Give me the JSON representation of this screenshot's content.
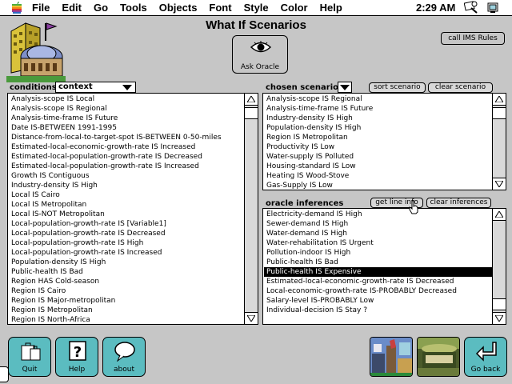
{
  "menubar": {
    "menus": [
      "File",
      "Edit",
      "Go",
      "Tools",
      "Objects",
      "Font",
      "Style",
      "Color",
      "Help"
    ],
    "clock": "2:29 AM"
  },
  "title": "What If Scenarios",
  "buttons": {
    "ask_oracle": "Ask Oracle",
    "call_ims_rules": "call IMS Rules",
    "sort_scenario": "sort scenario",
    "clear_scenario": "clear scenario",
    "get_line_info": "get line info",
    "clear_inferences": "clear inferences",
    "quit": "Quit",
    "help": "Help",
    "about": "about",
    "go_back": "Go back"
  },
  "conditions": {
    "label": "conditions",
    "context_value": "context",
    "items": [
      "Analysis-scope IS Local",
      "Analysis-scope IS Regional",
      "Analysis-time-frame IS Future",
      "Date IS-BETWEEN 1991-1995",
      "Distance-from-local-to-target-spot IS-BETWEEN 0-50-miles",
      "Estimated-local-economic-growth-rate IS Increased",
      "Estimated-local-population-growth-rate IS Decreased",
      "Estimated-local-population-growth-rate IS Increased",
      "Growth IS Contiguous",
      "Industry-density  IS High",
      "Local IS Cairo",
      "Local IS Metropolitan",
      "Local IS-NOT Metropolitan",
      "Local-population-growth-rate IS [Variable1]",
      "Local-population-growth-rate IS Decreased",
      "Local-population-growth-rate IS High",
      "Local-population-growth-rate IS Increased",
      "Population-density IS High",
      "Public-health IS Bad",
      "Region HAS Cold-season",
      "Region IS Cairo",
      "Region IS Major-metropolitan",
      "Region IS Metropolitan",
      "Region IS North-Africa"
    ]
  },
  "scenario": {
    "label": "chosen scenario",
    "items": [
      "Analysis-scope IS Regional",
      "Analysis-time-frame IS Future",
      "Industry-density  IS High",
      "Population-density IS High",
      "Region IS Metropolitan",
      "Productivity IS Low",
      "Water-supply IS Polluted",
      "Housing-standard IS Low",
      "Heating IS Wood-Stove",
      "Gas-Supply IS Low"
    ]
  },
  "inferences": {
    "label": "oracle inferences",
    "selected_index": 6,
    "items": [
      "Electricity-demand IS High",
      "Sewer-demand IS High",
      "Water-demand IS High",
      "Water-rehabilitation IS Urgent",
      "Pollution-indoor IS High",
      "Public-health IS Bad",
      "Public-health IS Expensive",
      "Estimated-local-economic-growth-rate IS Decreased",
      "Local-economic-growth-rate IS-PROBABLY Decreased",
      "Salary-level IS-PROBABLY Low",
      "Individual-decision IS Stay ?"
    ]
  },
  "colors": {
    "background": "#c6c6c6",
    "button_teal": "#5bbcc0",
    "selection": "#000000"
  }
}
